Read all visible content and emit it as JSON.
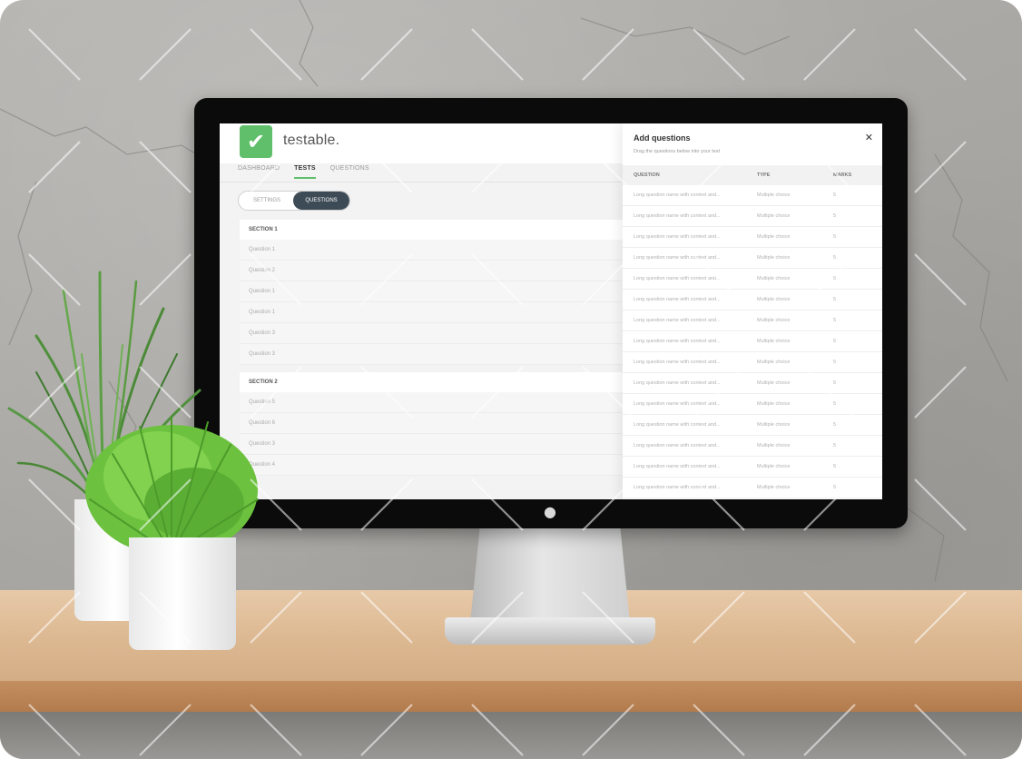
{
  "app": {
    "brand": "testable.",
    "nav_tabs": [
      {
        "label": "DASHBOARD",
        "active": false
      },
      {
        "label": "TESTS",
        "active": true
      },
      {
        "label": "QUESTIONS",
        "active": false
      }
    ],
    "toggle": {
      "left": "SETTINGS",
      "right": "QUESTIONS",
      "selected": "QUESTIONS"
    },
    "sections": [
      {
        "title": "SECTION 1",
        "questions": [
          "Question 1",
          "Question 2",
          "Question 1",
          "Question 1",
          "Question 3",
          "Question 3"
        ]
      },
      {
        "title": "SECTION 2",
        "questions": [
          "Question 5",
          "Question 6",
          "Question 3",
          "Question 4"
        ]
      }
    ]
  },
  "panel": {
    "title": "Add questions",
    "subtitle": "Drag the questions below into your test",
    "close_icon": "close-icon",
    "columns": [
      "QUESTION",
      "TYPE",
      "MARKS"
    ],
    "rows": [
      {
        "question": "Long question name with context and...",
        "type": "Multiple choice",
        "marks": "5"
      },
      {
        "question": "Long question name with context and...",
        "type": "Multiple choice",
        "marks": "5"
      },
      {
        "question": "Long question name with context and...",
        "type": "Multiple choice",
        "marks": "5"
      },
      {
        "question": "Long question name with context and...",
        "type": "Multiple choice",
        "marks": "5"
      },
      {
        "question": "Long question name with context and...",
        "type": "Multiple choice",
        "marks": "5"
      },
      {
        "question": "Long question name with context and...",
        "type": "Multiple choice",
        "marks": "5"
      },
      {
        "question": "Long question name with context and...",
        "type": "Multiple choice",
        "marks": "5"
      },
      {
        "question": "Long question name with context and...",
        "type": "Multiple choice",
        "marks": "5"
      },
      {
        "question": "Long question name with context and...",
        "type": "Multiple choice",
        "marks": "5"
      },
      {
        "question": "Long question name with context and...",
        "type": "Multiple choice",
        "marks": "5"
      },
      {
        "question": "Long question name with context and...",
        "type": "Multiple choice",
        "marks": "5"
      },
      {
        "question": "Long question name with context and...",
        "type": "Multiple choice",
        "marks": "5"
      },
      {
        "question": "Long question name with context and...",
        "type": "Multiple choice",
        "marks": "5"
      },
      {
        "question": "Long question name with context and...",
        "type": "Multiple choice",
        "marks": "5"
      },
      {
        "question": "Long question name with context and...",
        "type": "Multiple choice",
        "marks": "5"
      }
    ]
  },
  "colors": {
    "brand_green": "#5fbf6a",
    "toggle_dark": "#3d4b56"
  },
  "icons": {
    "logo": "checkmark-icon",
    "monitor": "apple-logo-icon"
  }
}
